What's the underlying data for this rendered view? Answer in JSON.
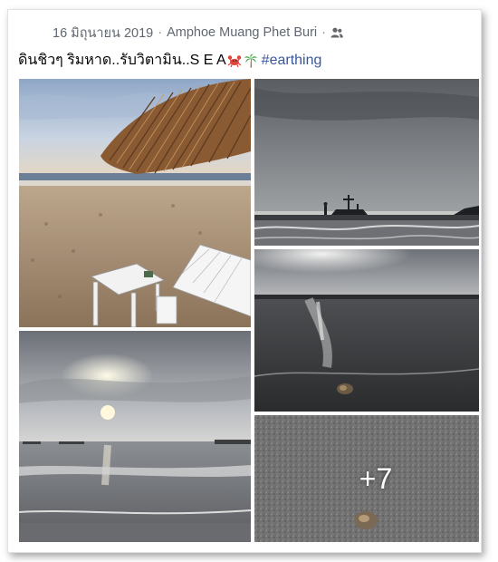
{
  "post": {
    "date": "16 มิถุนายน 2019",
    "location": "Amphoe Muang Phet Buri",
    "separator": "·",
    "audience_icon": "friends-icon",
    "caption_text": "ดินชิวๆ ริมหาด..รับวิตามิน..S E A",
    "caption_emojis": [
      "crab-emoji",
      "palm-tree-emoji"
    ],
    "hashtag": "#earthing"
  },
  "gallery": {
    "photos": [
      {
        "description": "beach hut thatched roof with white lounge chair and table on sand"
      },
      {
        "description": "silhouette of pirate ship statue on pier at dusk"
      },
      {
        "description": "wet sand beach reflecting sun with hermit crab"
      },
      {
        "description": "sun behind clouds over calm sea with waves"
      },
      {
        "description": "close-up of grey sand with hermit crab"
      }
    ],
    "more_count": "+7"
  }
}
